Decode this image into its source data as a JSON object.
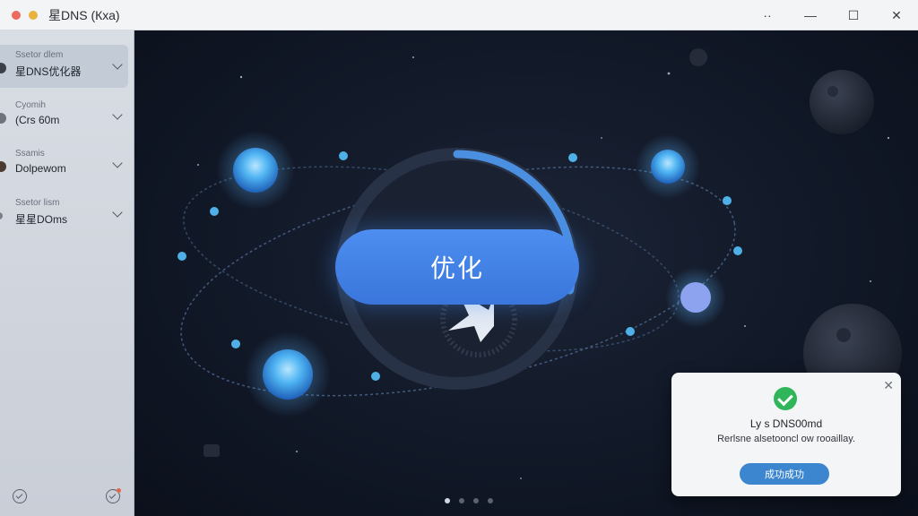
{
  "window": {
    "title": "星DNS (Кха)",
    "min_label": "—",
    "max_label": "☐",
    "close_label": "✕",
    "more_label": "··"
  },
  "sidebar": {
    "items": [
      {
        "caption": "Ssetor dlem",
        "value": "星DNS优化器"
      },
      {
        "caption": "Cyomih",
        "value": "(Crs 60m"
      },
      {
        "caption": "Ssamis",
        "value": "Dolpewom"
      },
      {
        "caption": "Ssetor lism",
        "value": "星星DOms"
      }
    ]
  },
  "main": {
    "optimize_label": "优化",
    "progress": 0.28,
    "pager": {
      "count": 4,
      "active": 0
    }
  },
  "toast": {
    "title": "Ly s DNS00md",
    "message": "Rerlsne alsetooncl ow rooaillay.",
    "button_label": "成功成功",
    "close_label": "✕"
  },
  "colors": {
    "accent": "#3a76db",
    "success": "#2fb55a",
    "toast_button": "#3b86cf",
    "background": "#111827"
  }
}
